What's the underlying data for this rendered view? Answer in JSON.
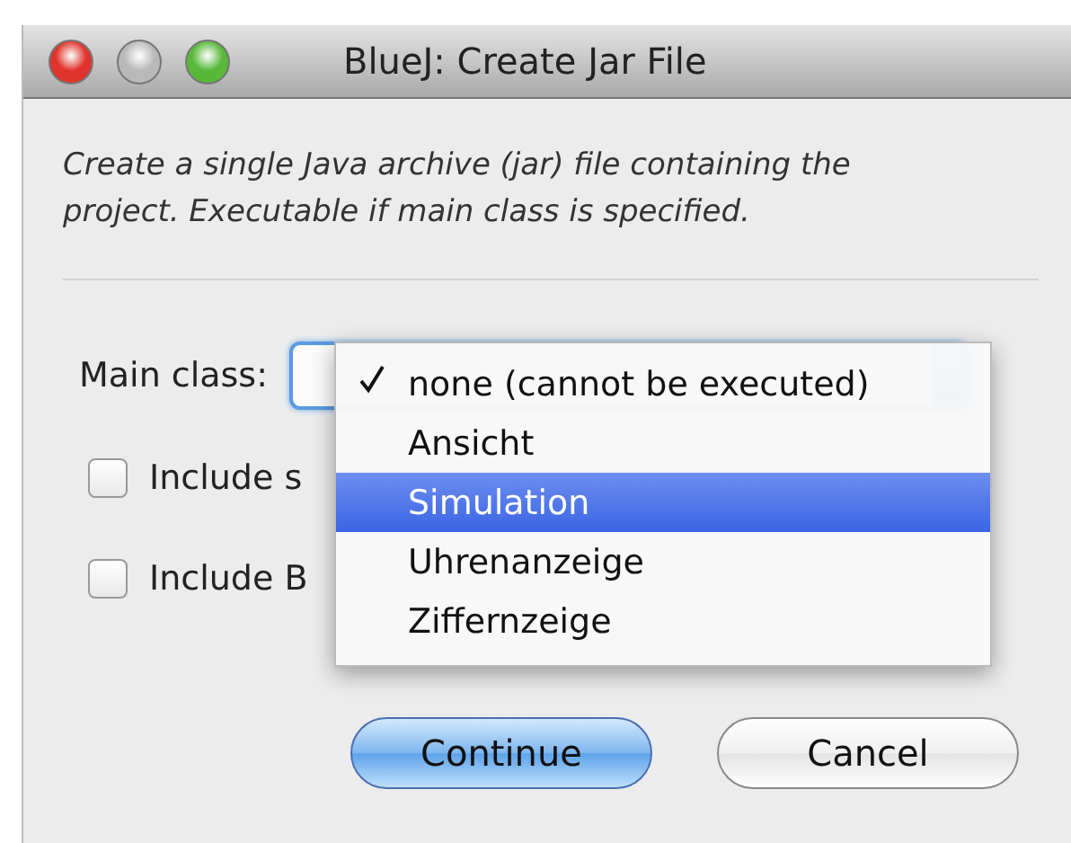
{
  "window": {
    "title": "BlueJ:  Create Jar File"
  },
  "description": "Create a single Java archive (jar) file containing the project. Executable if main class is specified.",
  "main_class": {
    "label": "Main class:"
  },
  "options": [
    {
      "label": "Include s",
      "checked": false
    },
    {
      "label": "Include B",
      "checked": false
    }
  ],
  "menu": [
    {
      "label": "none (cannot be executed)",
      "checked": true,
      "highlighted": false
    },
    {
      "label": "Ansicht",
      "checked": false,
      "highlighted": false
    },
    {
      "label": "Simulation",
      "checked": false,
      "highlighted": true
    },
    {
      "label": "Uhrenanzeige",
      "checked": false,
      "highlighted": false
    },
    {
      "label": "Ziffernzeige",
      "checked": false,
      "highlighted": false
    }
  ],
  "buttons": [
    {
      "label": "Continue",
      "kind": "default"
    },
    {
      "label": "Cancel",
      "kind": "normal"
    }
  ]
}
